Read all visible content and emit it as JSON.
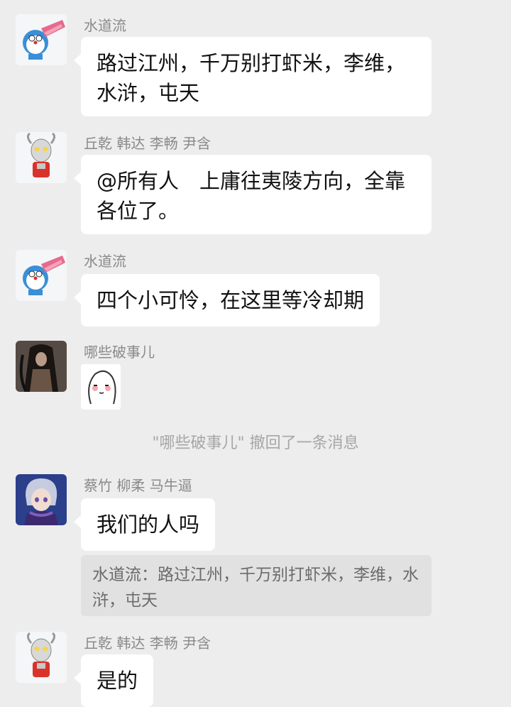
{
  "messages": [
    {
      "sender": "水道流",
      "text": "路过江州，千万别打虾米，李维，水浒，屯天",
      "avatar": "doraemon-avatar"
    },
    {
      "sender": "丘乾 韩达 李畅 尹含",
      "text": "@所有人　上庸往夷陵方向，全靠各位了。",
      "avatar": "ultraman-avatar"
    },
    {
      "sender": "水道流",
      "text": "四个小可怜，在这里等冷却期",
      "avatar": "doraemon-avatar"
    },
    {
      "sender": "哪些破事儿",
      "sticker": "blushing-face-sticker",
      "avatar": "dark-figure-avatar"
    },
    {
      "system": "\"哪些破事儿\" 撤回了一条消息"
    },
    {
      "sender": "蔡竹 柳柔 马牛逼",
      "text": "我们的人吗",
      "avatar": "anime-boy-avatar",
      "quote": "水道流：路过江州，千万别打虾米，李维，水浒，屯天"
    },
    {
      "sender": "丘乾 韩达 李畅 尹含",
      "text": "是的",
      "avatar": "ultraman-avatar"
    }
  ]
}
